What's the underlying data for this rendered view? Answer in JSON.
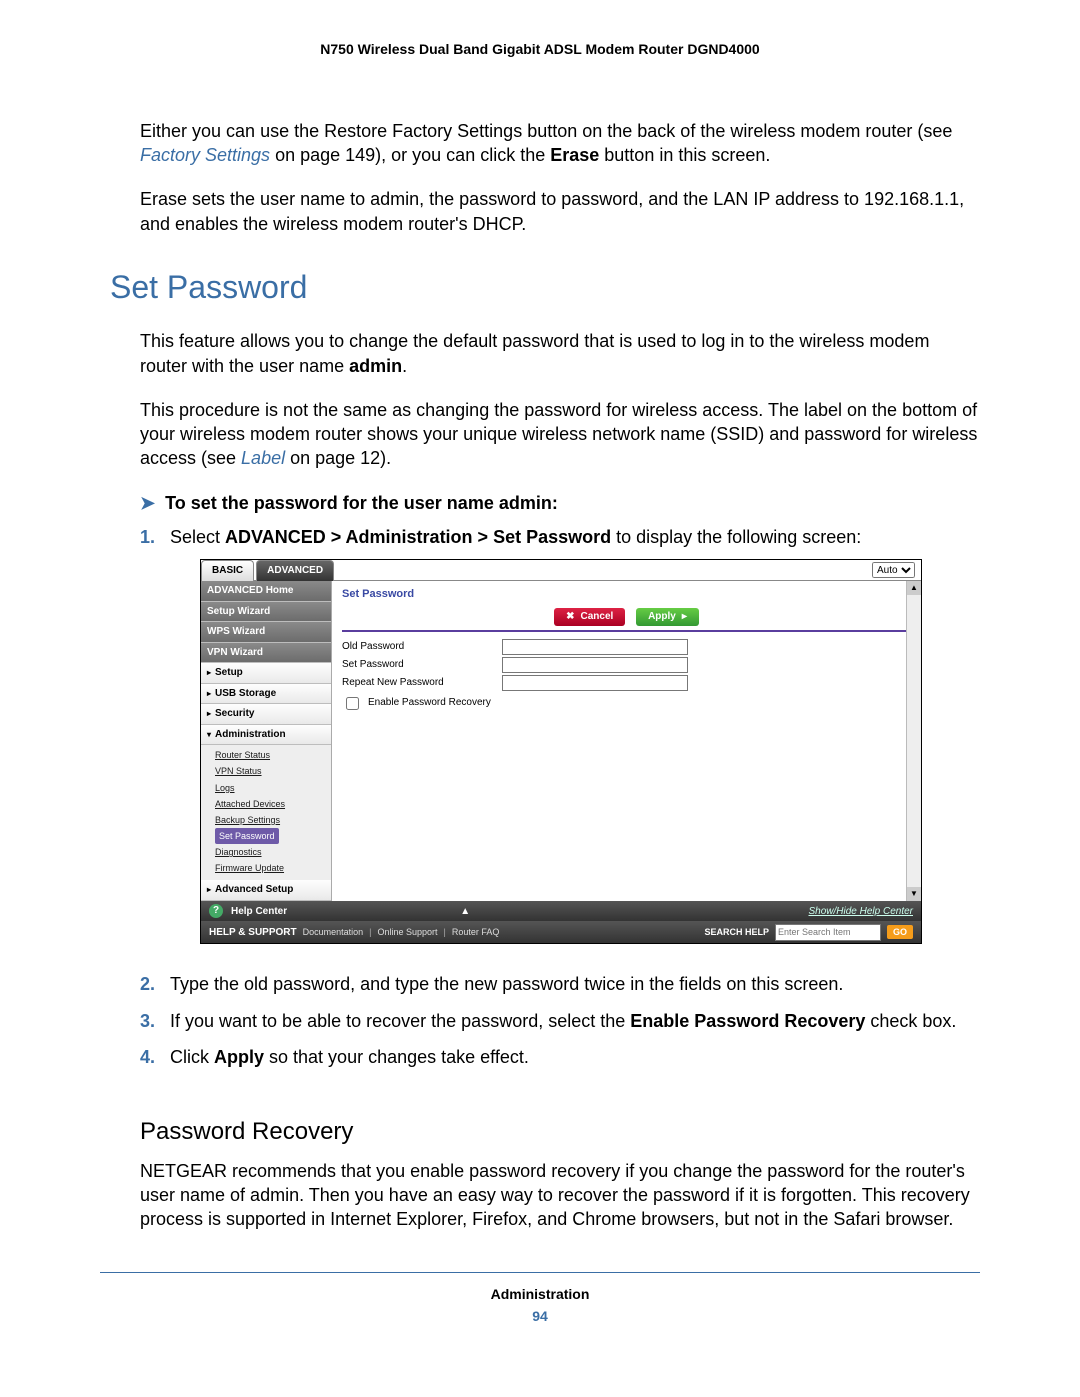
{
  "header": {
    "title": "N750 Wireless Dual Band Gigabit ADSL Modem Router DGND4000"
  },
  "intro": {
    "para1_a": "Either you can use the Restore Factory Settings button on the back of the wireless modem router (see ",
    "para1_link": "Factory Settings",
    "para1_b": " on page 149), or you can click the ",
    "para1_bold": "Erase",
    "para1_c": " button in this screen.",
    "para2": "Erase sets the user name to admin, the password to password, and the LAN IP address to 192.168.1.1, and enables the wireless modem router's DHCP."
  },
  "section": {
    "title": "Set Password",
    "p1_a": "This feature allows you to change the default password that is used to log in to the wireless modem router with the user name ",
    "p1_bold": "admin",
    "p1_b": ".",
    "p2_a": "This procedure is not the same as changing the password for wireless access. The label on the bottom of your wireless modem router shows your unique wireless network name (SSID) and password for wireless access (see ",
    "p2_link": "Label",
    "p2_b": " on page 12).",
    "task": "To set the password for the user name admin:"
  },
  "steps": {
    "s1_a": "Select ",
    "s1_bold": "ADVANCED > Administration > Set Password",
    "s1_b": " to display the following screen:",
    "s2": "Type the old password, and type the new password twice in the fields on this screen.",
    "s3_a": "If you want to be able to recover the password, select the ",
    "s3_bold": "Enable Password Recovery",
    "s3_b": " check box.",
    "s4_a": "Click ",
    "s4_bold": "Apply",
    "s4_b": " so that your changes take effect."
  },
  "router": {
    "tabs": {
      "basic": "BASIC",
      "advanced": "ADVANCED",
      "auto": "Auto"
    },
    "nav": {
      "home": "ADVANCED Home",
      "setup_wiz": "Setup Wizard",
      "wps_wiz": "WPS Wizard",
      "vpn_wiz": "VPN Wizard",
      "setup": "Setup",
      "usb": "USB Storage",
      "security": "Security",
      "admin": "Administration",
      "adv_setup": "Advanced Setup",
      "sub": {
        "router_status": "Router Status",
        "vpn_status": "VPN Status",
        "logs": "Logs",
        "attached": "Attached Devices",
        "backup": "Backup Settings",
        "set_pw": "Set Password",
        "diag": "Diagnostics",
        "fw": "Firmware Update"
      }
    },
    "panel": {
      "title": "Set Password",
      "cancel": "Cancel",
      "apply": "Apply",
      "old": "Old Password",
      "new": "Set Password",
      "repeat": "Repeat New Password",
      "recover": "Enable Password Recovery"
    },
    "help": {
      "center": "Help Center",
      "show": "Show/Hide Help Center"
    },
    "support": {
      "lead": "HELP & SUPPORT",
      "doc": "Documentation",
      "online": "Online Support",
      "faq": "Router FAQ",
      "search_label": "SEARCH HELP",
      "search_ph": "Enter Search Item",
      "go": "GO"
    }
  },
  "recovery": {
    "title": "Password Recovery",
    "p": "NETGEAR recommends that you enable password recovery if you change the password for the router's user name of admin. Then you have an easy way to recover the password if it is forgotten. This recovery process is supported in Internet Explorer, Firefox, and Chrome browsers, but not in the Safari browser."
  },
  "footer": {
    "section": "Administration",
    "page": "94"
  }
}
